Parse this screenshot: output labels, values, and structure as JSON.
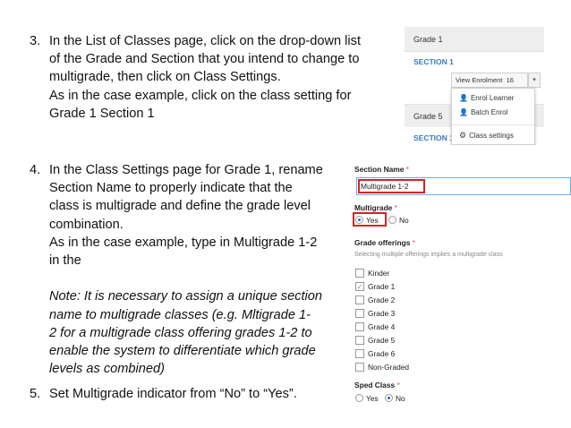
{
  "step3": {
    "number": "3.",
    "lines": [
      "In the List of Classes page, click on the drop-down list",
      "of the  Grade and Section that you intend to change to",
      "multigrade, then click on Class Settings.",
      "As in the case example, click on the class setting for",
      "Grade 1 Section 1"
    ]
  },
  "step4": {
    "number": "4.",
    "lines": [
      "In the Class Settings page for Grade 1, rename",
      "Section Name to properly indicate that the",
      "class is multigrade and define the grade level",
      "combination.",
      "As in the case example, type in Multigrade 1-2",
      "in the"
    ],
    "note_lines": [
      "Note: It is necessary to assign a unique section",
      "name to multigrade classes  (e.g. Mltigrade 1-",
      "2 for a multigrade  class offering grades 1-2 to",
      "enable the system to differentiate which grade",
      "levels as combined)"
    ]
  },
  "step5": {
    "number": "5.",
    "text": "Set Multigrade indicator from “No” to “Yes”."
  },
  "shot1": {
    "grade1": "Grade 1",
    "section1": "SECTION 1",
    "view_enrolment": "View Enrolment",
    "enrolment_count": "16",
    "grade5": "Grade 5",
    "section1_b": "SECTION 1",
    "menu": {
      "enrol_learner": "Enrol Learner",
      "batch_enrol": "Batch Enrol",
      "class_settings": "Class settings"
    }
  },
  "shot2": {
    "section_name_label": "Section Name",
    "required_mark": "*",
    "section_name_value": "Multigrade 1-2",
    "multigrade_label": "Multigrade",
    "yes": "Yes",
    "no": "No",
    "grade_offerings_label": "Grade offerings",
    "helper_text": "Selecting multiple offerings implies a multigrade class",
    "offerings": [
      {
        "label": "Kinder",
        "checked": false
      },
      {
        "label": "Grade 1",
        "checked": true
      },
      {
        "label": "Grade 2",
        "checked": false
      },
      {
        "label": "Grade 3",
        "checked": false
      },
      {
        "label": "Grade 4",
        "checked": false
      },
      {
        "label": "Grade 5",
        "checked": false
      },
      {
        "label": "Grade 6",
        "checked": false
      },
      {
        "label": "Non-Graded",
        "checked": false
      }
    ],
    "sped_label": "Sped Class",
    "sped_yes": "Yes",
    "sped_no": "No"
  },
  "colors": {
    "highlight": "#d8202a",
    "link_blue": "#3b7bc0",
    "required_red": "#d9534f"
  }
}
